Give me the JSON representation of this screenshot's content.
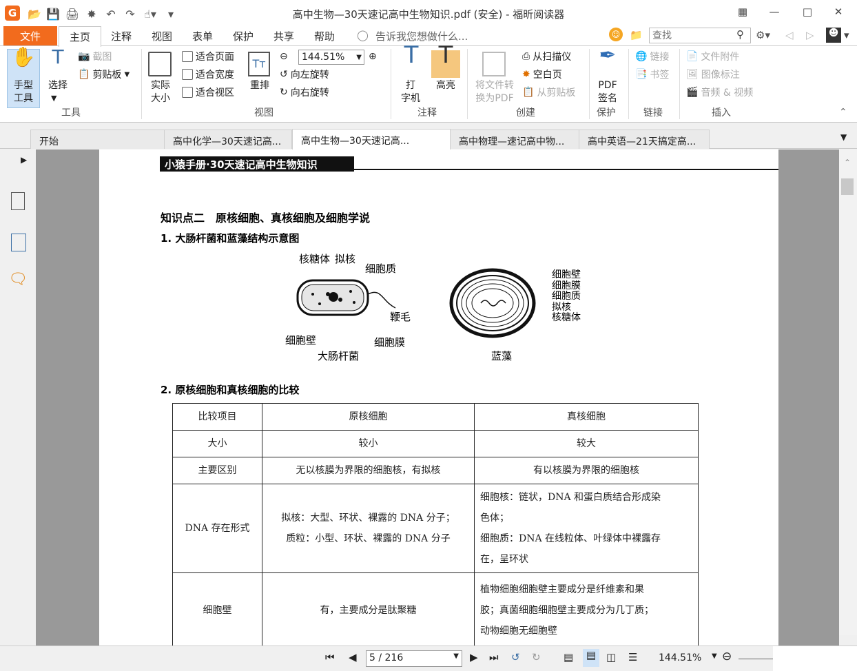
{
  "window": {
    "title": "高中生物—30天速记高中生物知识.pdf (安全) - 福昕阅读器"
  },
  "menu": {
    "file": "文件",
    "tabs": [
      "主页",
      "注释",
      "视图",
      "表单",
      "保护",
      "共享",
      "帮助"
    ],
    "tell_me": "告诉我您想做什么...",
    "search_placeholder": "查找"
  },
  "ribbon": {
    "hand_tool": "手型\n工具",
    "select": "选择",
    "screenshot": "截图",
    "clipboard": "剪贴板",
    "group_tools": "工具",
    "actual_size": "实际\n大小",
    "fit_page": "适合页面",
    "fit_width": "适合宽度",
    "fit_visible": "适合视区",
    "reflow": "重排",
    "zoom_value": "144.51%",
    "rotate_left": "向左旋转",
    "rotate_right": "向右旋转",
    "group_view": "视图",
    "typewriter": "打\n字机",
    "highlight": "高亮",
    "group_comment": "注释",
    "convert_pdf": "将文件转\n换为PDF",
    "from_scanner": "从扫描仪",
    "blank_page": "空白页",
    "from_clipboard": "从剪贴板",
    "group_create": "创建",
    "pdf_sign": "PDF\n签名",
    "group_protect": "保护",
    "link": "链接",
    "bookmark": "书签",
    "group_links": "链接",
    "file_attach": "文件附件",
    "image_mark": "图像标注",
    "audio_video": "音频 & 视频",
    "group_insert": "插入"
  },
  "doc_tabs": [
    "开始",
    "高中化学—30天速记高...",
    "高中生物—30天速记高...",
    "高中物理—速记高中物...",
    "高中英语—21天搞定高..."
  ],
  "page": {
    "banner": "小猿手册·30天速记高中生物知识",
    "heading": "知识点二　原核细胞、真核细胞及细胞学说",
    "sub1": "1. 大肠杆菌和蓝藻结构示意图",
    "ecoli": {
      "ribosome": "核糖体",
      "nucleoid": "拟核",
      "cytoplasm": "细胞质",
      "flagellum": "鞭毛",
      "cell_wall": "细胞壁",
      "membrane": "细胞膜",
      "caption": "大肠杆菌"
    },
    "algae": {
      "labels": [
        "细胞壁",
        "细胞膜",
        "细胞质",
        "拟核",
        "核糖体"
      ],
      "caption": "蓝藻"
    },
    "sub2": "2. 原核细胞和真核细胞的比较",
    "table": {
      "header": [
        "比较项目",
        "原核细胞",
        "真核细胞"
      ],
      "rows": [
        [
          "大小",
          "较小",
          "较大"
        ],
        [
          "主要区别",
          "无以核膜为界限的细胞核，有拟核",
          "有以核膜为界限的细胞核"
        ],
        [
          "DNA 存在形式",
          "拟核：大型、环状、裸露的 DNA 分子；\n质粒：小型、环状、裸露的 DNA 分子",
          "细胞核：链状，DNA 和蛋白质结合形成染\n色体；\n细胞质：DNA 在线粒体、叶绿体中裸露存\n在，呈环状"
        ],
        [
          "细胞壁",
          "有，主要成分是肽聚糖",
          "植物细胞细胞壁主要成分是纤维素和果\n胶；真菌细胞细胞壁主要成分为几丁质；\n动物细胞无细胞壁"
        ]
      ]
    }
  },
  "status": {
    "page_input": "5 / 216",
    "zoom": "144.51%"
  }
}
